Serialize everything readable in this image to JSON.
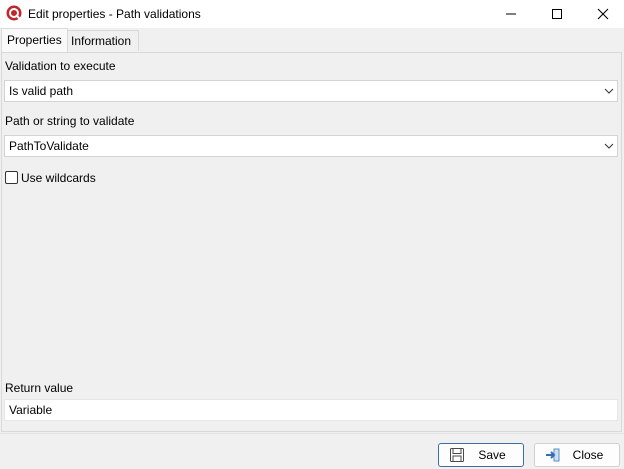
{
  "window": {
    "title": "Edit properties - Path validations",
    "controls": {
      "minimize_icon": "minimize-icon",
      "maximize_icon": "maximize-icon",
      "close_icon": "close-icon"
    }
  },
  "tabs": [
    {
      "label": "Properties",
      "active": true
    },
    {
      "label": "Information",
      "active": false
    }
  ],
  "form": {
    "validation_label": "Validation to execute",
    "validation_value": "Is valid path",
    "path_label": "Path or string to validate",
    "path_value": "PathToValidate",
    "wildcards_label": "Use wildcards",
    "wildcards_checked": false,
    "return_label": "Return value",
    "return_value": "Variable"
  },
  "footer": {
    "save_label": "Save",
    "close_label": "Close"
  },
  "colors": {
    "app_icon_red": "#c0272d",
    "save_border": "#3b6ea8",
    "background": "#f0f0f0"
  }
}
